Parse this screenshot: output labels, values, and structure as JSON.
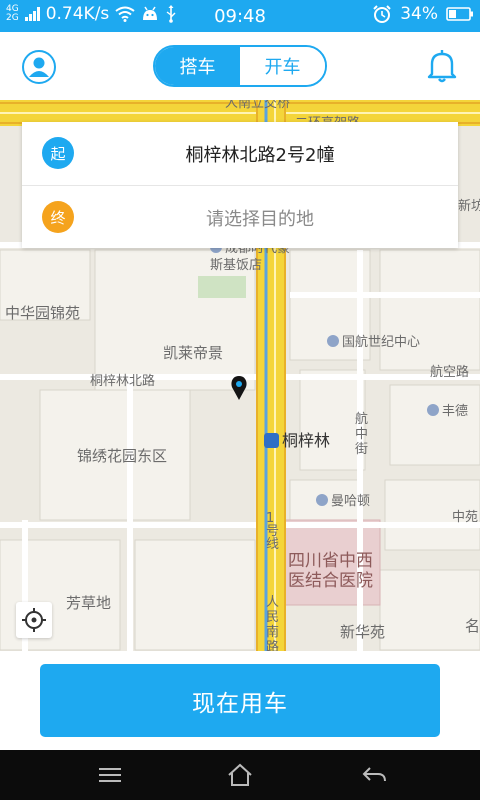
{
  "status_bar": {
    "network_top": "4G",
    "network_bottom": "2G",
    "speed": "0.74K/s",
    "time": "09:48",
    "battery": "34%",
    "icons": [
      "signal-icon",
      "wifi-icon",
      "android-icon",
      "usb-icon",
      "alarm-icon",
      "battery-icon"
    ]
  },
  "header": {
    "tabs": [
      {
        "label": "搭车",
        "active": true
      },
      {
        "label": "开车",
        "active": false
      }
    ],
    "avatar_icon": "user-icon",
    "bell_icon": "bell-icon"
  },
  "address": {
    "start_badge": "起",
    "start_value": "桐梓林北路2号2幢",
    "end_badge": "终",
    "end_placeholder": "请选择目的地"
  },
  "map": {
    "labels": {
      "bridge": "人南立交桥",
      "ring_road": "二环高架路",
      "hotel": "成都时代豪斯基饭店",
      "garden": "中华园锦苑",
      "kailai": "凯莱帝景",
      "airline": "国航世纪中心",
      "tongzilin_road": "桐梓林北路",
      "hangkong_road": "航空路",
      "hangzhong_street": "航中街",
      "fengde": "丰德",
      "tongzilin_station": "桐梓林",
      "jinxiu": "锦绣花园东区",
      "manhadun": "曼哈顿",
      "line1": "1号线",
      "hospital": "四川省中西医结合医院",
      "fangcaodi": "芳草地",
      "renmin_south": "人民南路",
      "xinhuayuan": "新华苑",
      "edge_xin": "新坊",
      "edge_zhong": "中苑",
      "edge_ming": "名"
    }
  },
  "actions": {
    "primary_label": "现在用车",
    "locate_icon": "locate-icon"
  },
  "colors": {
    "accent": "#1ea9f0",
    "end_badge": "#f5a31d",
    "map_bg": "#ece9e1",
    "road_main": "#f4d53a",
    "hospital": "#e9cfd0"
  },
  "nav_bar": {
    "icons": [
      "menu-icon",
      "home-icon",
      "back-icon"
    ]
  }
}
